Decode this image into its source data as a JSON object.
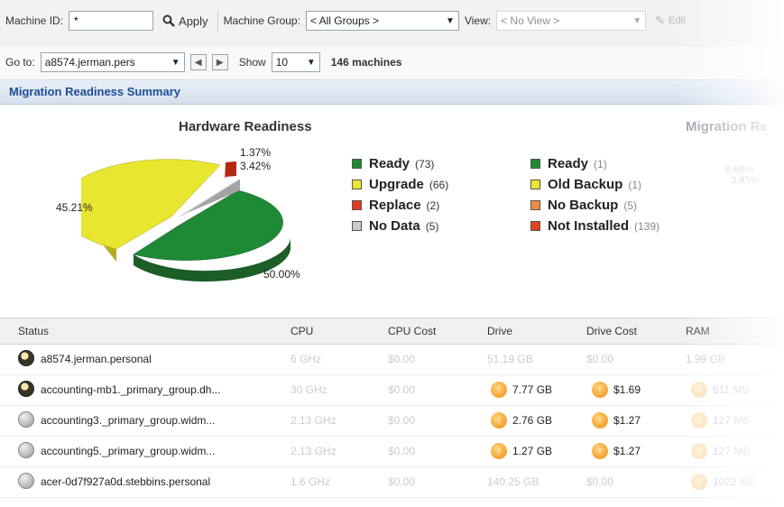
{
  "toolbar": {
    "machine_id_label": "Machine ID:",
    "machine_id_value": "*",
    "apply_label": "Apply",
    "machine_group_label": "Machine Group:",
    "machine_group_value": "< All Groups >",
    "view_label": "View:",
    "view_value": "< No View >",
    "edit_label": "Edit",
    "goto_label": "Go to:",
    "goto_value": "a8574.jerman.pers",
    "show_label": "Show",
    "show_value": "10",
    "machines_count": "146 machines"
  },
  "summary": {
    "title": "Migration Readiness Summary",
    "hardware": {
      "title": "Hardware Readiness",
      "pct_labels": [
        "45.21%",
        "1.37%",
        "3.42%",
        "50.00%"
      ],
      "legend": [
        {
          "label": "Ready",
          "count": "(73)",
          "color": "#1f8a36"
        },
        {
          "label": "Upgrade",
          "count": "(66)",
          "color": "#e9e62f"
        },
        {
          "label": "Replace",
          "count": "(2)",
          "color": "#e23a22"
        },
        {
          "label": "No Data",
          "count": "(5)",
          "color": "#c9c9c9"
        }
      ]
    },
    "migration": {
      "title": "Migration Re",
      "pct_labels": [
        "0.68%",
        "3.45%"
      ],
      "legend": [
        {
          "label": "Ready",
          "count": "(1)",
          "color": "#1f8a36"
        },
        {
          "label": "Old Backup",
          "count": "(1)",
          "color": "#e9e62f"
        },
        {
          "label": "No Backup",
          "count": "(5)",
          "color": "#f08a3c"
        },
        {
          "label": "Not Installed",
          "count": "(139)",
          "color": "#e0451d"
        }
      ]
    }
  },
  "chart_data": [
    {
      "type": "pie",
      "title": "Hardware Readiness",
      "categories": [
        "Ready",
        "Upgrade",
        "Replace",
        "No Data"
      ],
      "values": [
        73,
        66,
        2,
        5
      ],
      "percent_labels": [
        "50.00%",
        "45.21%",
        "1.37%",
        "3.42%"
      ],
      "colors": [
        "#1f8a36",
        "#e9e62f",
        "#e23a22",
        "#c9c9c9"
      ],
      "legend": "right"
    },
    {
      "type": "pie",
      "title": "Migration Re",
      "categories": [
        "Ready",
        "Old Backup",
        "No Backup",
        "Not Installed"
      ],
      "values": [
        1,
        1,
        5,
        139
      ],
      "colors": [
        "#1f8a36",
        "#e9e62f",
        "#f08a3c",
        "#e0451d"
      ],
      "legend": "left"
    }
  ],
  "table": {
    "columns": [
      "Status",
      "CPU",
      "CPU Cost",
      "Drive",
      "Drive Cost",
      "RAM"
    ],
    "rows": [
      {
        "name": "a8574.jerman.personal",
        "status": "dark",
        "cpu": "6 GHz",
        "cpu_cost": "$0.00",
        "drive": "51.19 GB",
        "drive_up": false,
        "drive_cost": "$0.00",
        "cost_up": false,
        "ram": "1.99 GB",
        "ram_up": false
      },
      {
        "name": "accounting-mb1._primary_group.dh...",
        "status": "dark",
        "cpu": "30 GHz",
        "cpu_cost": "$0.00",
        "drive": "7.77 GB",
        "drive_up": true,
        "drive_cost": "$1.69",
        "cost_up": true,
        "ram": "511 MB",
        "ram_up": true
      },
      {
        "name": "accounting3._primary_group.widm...",
        "status": "grey",
        "cpu": "2.13 GHz",
        "cpu_cost": "$0.00",
        "drive": "2.76 GB",
        "drive_up": true,
        "drive_cost": "$1.27",
        "cost_up": true,
        "ram": "127 MB",
        "ram_up": true
      },
      {
        "name": "accounting5._primary_group.widm...",
        "status": "grey",
        "cpu": "2.13 GHz",
        "cpu_cost": "$0.00",
        "drive": "1.27 GB",
        "drive_up": true,
        "drive_cost": "$1.27",
        "cost_up": true,
        "ram": "127 MB",
        "ram_up": true
      },
      {
        "name": "acer-0d7f927a0d.stebbins.personal",
        "status": "grey",
        "cpu": "1.6 GHz",
        "cpu_cost": "$0.00",
        "drive": "140.25 GB",
        "drive_up": false,
        "drive_cost": "$0.00",
        "cost_up": false,
        "ram": "1022 MB",
        "ram_up": true
      }
    ]
  }
}
